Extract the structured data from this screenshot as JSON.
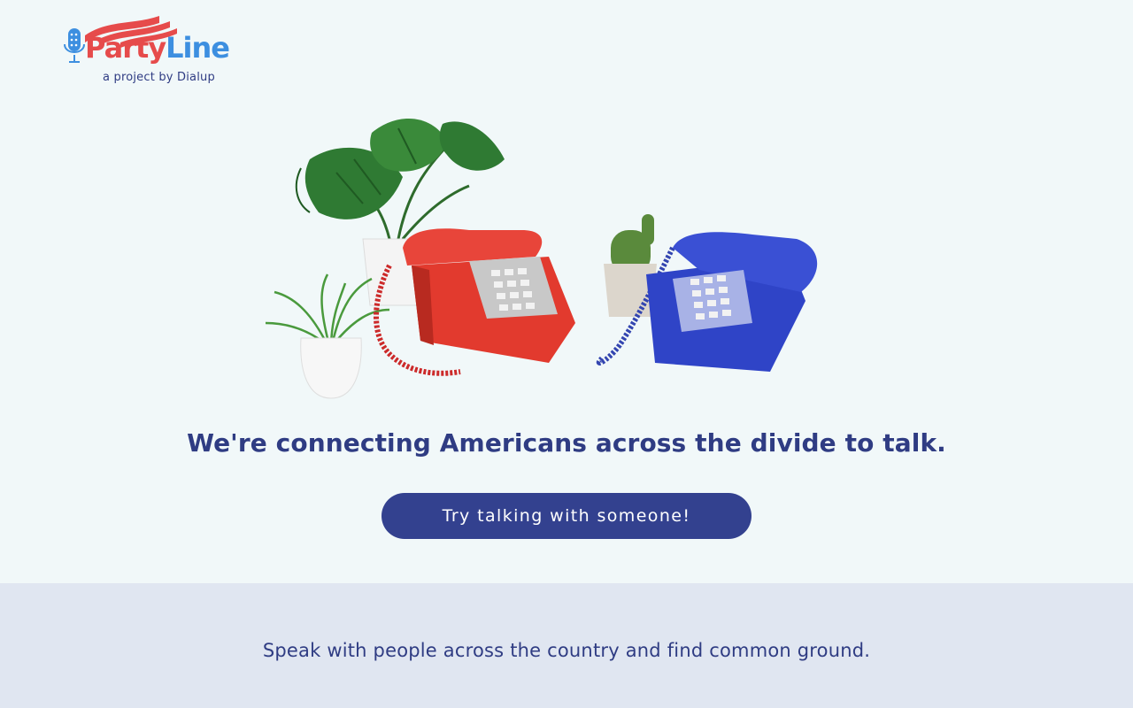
{
  "logo": {
    "word_party": "Party",
    "word_line": "Line",
    "subtitle": "a project by Dialup",
    "party_color": "#e64b4b",
    "line_color": "#3d8fe0"
  },
  "hero": {
    "left_phone_color": "#e23a2e",
    "right_phone_color": "#2f44c7"
  },
  "headline": "We're connecting Americans across the divide to talk.",
  "cta": {
    "label": "Try talking with someone!",
    "color": "#33418f"
  },
  "footer_band": {
    "tagline": "Speak with people across the country and find common ground.",
    "background": "#e0e6f1"
  }
}
